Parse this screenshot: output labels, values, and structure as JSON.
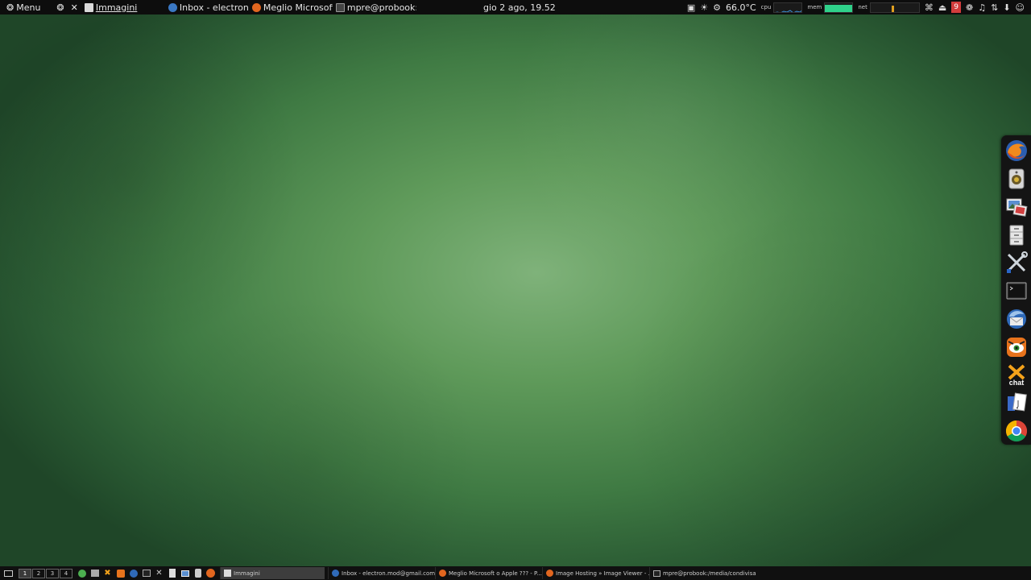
{
  "top_panel": {
    "menu_label": "Menu",
    "tasks": [
      {
        "label": "Immagini",
        "icon": "folder-icon",
        "active": true
      },
      {
        "label": "Inbox - electron...",
        "icon": "thunderbird-icon",
        "active": false
      },
      {
        "label": "Meglio Microsoft...",
        "icon": "firefox-icon",
        "active": false
      },
      {
        "label": "mpre@probook:/...",
        "icon": "terminal-icon",
        "active": false
      }
    ],
    "clock": "gio  2 ago, 19.52",
    "temperature": "66.0°C",
    "monitors": [
      {
        "label": "cpu",
        "color": "#3a8fd6"
      },
      {
        "label": "mem",
        "color": "#2fd18a"
      },
      {
        "label": "net",
        "color": "#e0a020"
      }
    ],
    "notification_count": "9"
  },
  "dock": {
    "apps": [
      {
        "name": "Firefox",
        "icon": "firefox-icon"
      },
      {
        "name": "Music player",
        "icon": "speaker-icon"
      },
      {
        "name": "Image viewer",
        "icon": "image-viewer-icon"
      },
      {
        "name": "File manager",
        "icon": "file-cabinet-icon"
      },
      {
        "name": "Settings",
        "icon": "tools-icon"
      },
      {
        "name": "Terminal",
        "icon": "terminal-icon"
      },
      {
        "name": "Thunderbird",
        "icon": "thunderbird-icon"
      },
      {
        "name": "Screen capture",
        "icon": "tiger-icon"
      },
      {
        "name": "X-Chat",
        "icon": "xchat-icon"
      },
      {
        "name": "Text editor",
        "icon": "document-icon"
      },
      {
        "name": "Chrome",
        "icon": "chrome-icon"
      }
    ]
  },
  "bottom_panel": {
    "workspaces": [
      "1",
      "2",
      "3",
      "4"
    ],
    "tasks": [
      {
        "label": "Immagini",
        "icon": "folder-icon",
        "active": true
      },
      {
        "label": "Inbox - electron.mod@gmail.com...",
        "icon": "thunderbird-icon",
        "active": false
      },
      {
        "label": "Meglio Microsoft o Apple ??? - P...",
        "icon": "firefox-icon",
        "active": false
      },
      {
        "label": "Image Hosting » Image Viewer - ...",
        "icon": "firefox-icon",
        "active": false
      },
      {
        "label": "mpre@probook:/media/condivisa...",
        "icon": "terminal-icon",
        "active": false
      }
    ]
  }
}
